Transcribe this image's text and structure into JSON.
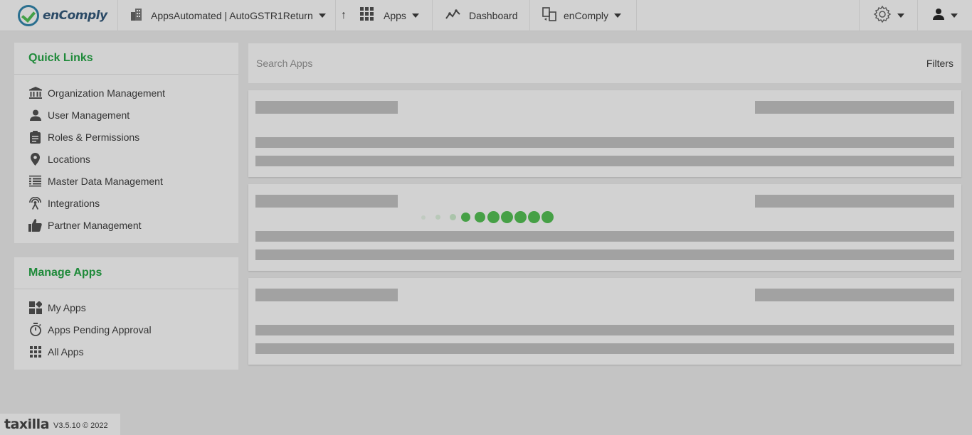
{
  "header": {
    "brand": "enComply",
    "workspace": "AppsAutomated | AutoGSTR1Return",
    "apps_label": "Apps",
    "dashboard_label": "Dashboard",
    "product_label": "enComply"
  },
  "sidebar": {
    "quick_links": {
      "title": "Quick Links",
      "items": [
        {
          "label": "Organization Management",
          "icon": "bank-icon"
        },
        {
          "label": "User Management",
          "icon": "person-icon"
        },
        {
          "label": "Roles & Permissions",
          "icon": "clipboard-icon"
        },
        {
          "label": "Locations",
          "icon": "map-pin-icon"
        },
        {
          "label": "Master Data Management",
          "icon": "data-list-icon"
        },
        {
          "label": "Integrations",
          "icon": "antenna-icon"
        },
        {
          "label": "Partner Management",
          "icon": "thumbs-up-icon"
        }
      ]
    },
    "manage_apps": {
      "title": "Manage Apps",
      "items": [
        {
          "label": "My Apps",
          "icon": "widgets-icon"
        },
        {
          "label": "Apps Pending Approval",
          "icon": "stopwatch-icon"
        },
        {
          "label": "All Apps",
          "icon": "grid-icon"
        }
      ]
    }
  },
  "main": {
    "search_placeholder": "Search Apps",
    "filters_label": "Filters"
  },
  "footer": {
    "logo": "taxilla",
    "version": "V3.5.10 © 2022"
  },
  "colors": {
    "accent_green": "#1f8a3a",
    "loader_green": "#46a046",
    "background": "#c4c4c4",
    "panel": "#d2d2d2",
    "skeleton": "#a2a2a2"
  }
}
